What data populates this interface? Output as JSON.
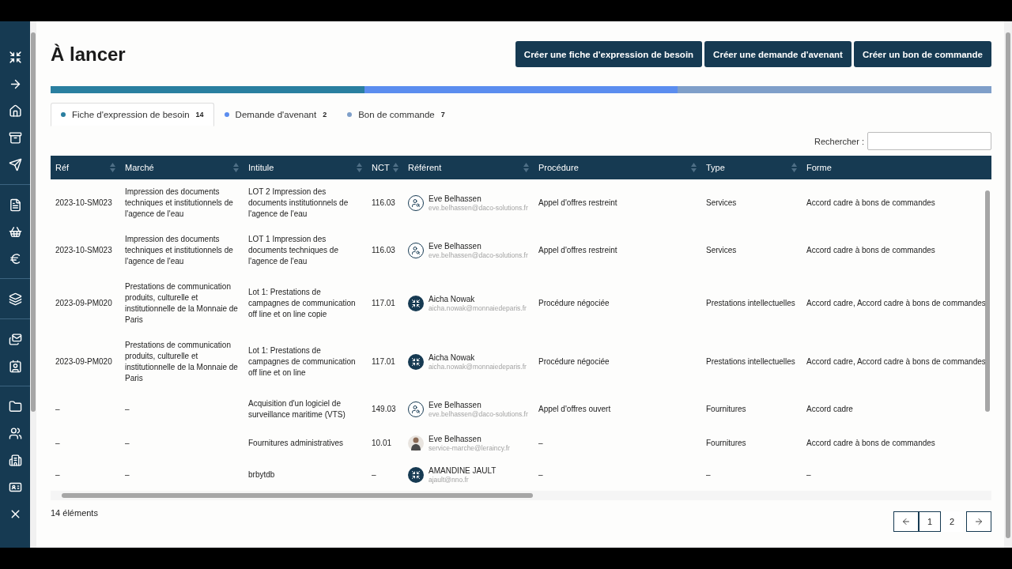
{
  "title": "À lancer",
  "actions": [
    "Créer une fiche d'expression de besoin",
    "Créer une demande d'avenant",
    "Créer un bon de commande"
  ],
  "progress": [
    {
      "color": "#2a7fa0"
    },
    {
      "color": "#5b8def"
    },
    {
      "color": "#7f9fc9"
    }
  ],
  "tabs": [
    {
      "label": "Fiche d'expression de besoin",
      "count": "14",
      "color": "#2a7fa0",
      "selected": true
    },
    {
      "label": "Demande d'avenant",
      "count": "2",
      "color": "#5b8def",
      "selected": false
    },
    {
      "label": "Bon de commande",
      "count": "7",
      "color": "#7f9fc9",
      "selected": false
    }
  ],
  "search": {
    "label": "Rechercher :"
  },
  "table": {
    "columns": [
      "Réf",
      "Marché",
      "Intitule",
      "NCT",
      "Référent",
      "Procédure",
      "Type",
      "Forme"
    ],
    "rows": [
      {
        "ref": "2023-10-SM023",
        "marche": "Impression des documents techniques et institutionnels de l'agence de l'eau",
        "intitule": "LOT 2 Impression des documents institutionnels de l'agence de l'eau",
        "nct": "116.03",
        "referent": {
          "kind": "outline",
          "name": "Eve Belhassen",
          "email": "eve.belhassen@daco-solutions.fr"
        },
        "procedure": "Appel d'offres restreint",
        "type": "Services",
        "forme": "Accord cadre à bons de commandes"
      },
      {
        "ref": "2023-10-SM023",
        "marche": "Impression des documents techniques et institutionnels de l'agence de l'eau",
        "intitule": "LOT 1 Impression des documents techniques de l'agence de l'eau",
        "nct": "116.03",
        "referent": {
          "kind": "outline",
          "name": "Eve Belhassen",
          "email": "eve.belhassen@daco-solutions.fr"
        },
        "procedure": "Appel d'offres restreint",
        "type": "Services",
        "forme": "Accord cadre à bons de commandes"
      },
      {
        "ref": "2023-09-PM020",
        "marche": "Prestations de communication produits, culturelle et institutionnelle de la Monnaie de Paris",
        "intitule": "Lot 1: Prestations de campagnes de communication off line et on line copie",
        "nct": "117.01",
        "referent": {
          "kind": "filled",
          "name": "Aicha Nowak",
          "email": "aicha.nowak@monnaiedeparis.fr"
        },
        "procedure": "Procédure négociée",
        "type": "Prestations intellectuelles",
        "forme": "Accord cadre, Accord cadre à bons de commandes"
      },
      {
        "ref": "2023-09-PM020",
        "marche": "Prestations de communication produits, culturelle et institutionnelle de la Monnaie de Paris",
        "intitule": "Lot 1: Prestations de campagnes de communication off line et on line",
        "nct": "117.01",
        "referent": {
          "kind": "filled",
          "name": "Aicha Nowak",
          "email": "aicha.nowak@monnaiedeparis.fr"
        },
        "procedure": "Procédure négociée",
        "type": "Prestations intellectuelles",
        "forme": "Accord cadre, Accord cadre à bons de commandes"
      },
      {
        "ref": "–",
        "marche": "–",
        "intitule": "Acquisition d'un logiciel de surveillance maritime (VTS)",
        "nct": "149.03",
        "referent": {
          "kind": "outline",
          "name": "Eve Belhassen",
          "email": "eve.belhassen@daco-solutions.fr"
        },
        "procedure": "Appel d'offres ouvert",
        "type": "Fournitures",
        "forme": "Accord cadre"
      },
      {
        "ref": "–",
        "marche": "–",
        "intitule": "Fournitures administratives",
        "nct": "10.01",
        "referent": {
          "kind": "photo",
          "name": "Eve Belhassen",
          "email": "service-marche@leraincy.fr"
        },
        "procedure": "–",
        "type": "Fournitures",
        "forme": "Accord cadre à bons de commandes"
      },
      {
        "ref": "–",
        "marche": "–",
        "intitule": "brbytdb",
        "nct": "–",
        "referent": {
          "kind": "filled",
          "name": "AMANDINE JAULT",
          "email": "ajault@nno.fr"
        },
        "procedure": "–",
        "type": "–",
        "forme": "–"
      }
    ]
  },
  "footer": {
    "count": "14 éléments",
    "pages": [
      {
        "label": "1",
        "selected": true
      },
      {
        "label": "2",
        "selected": false
      }
    ]
  }
}
